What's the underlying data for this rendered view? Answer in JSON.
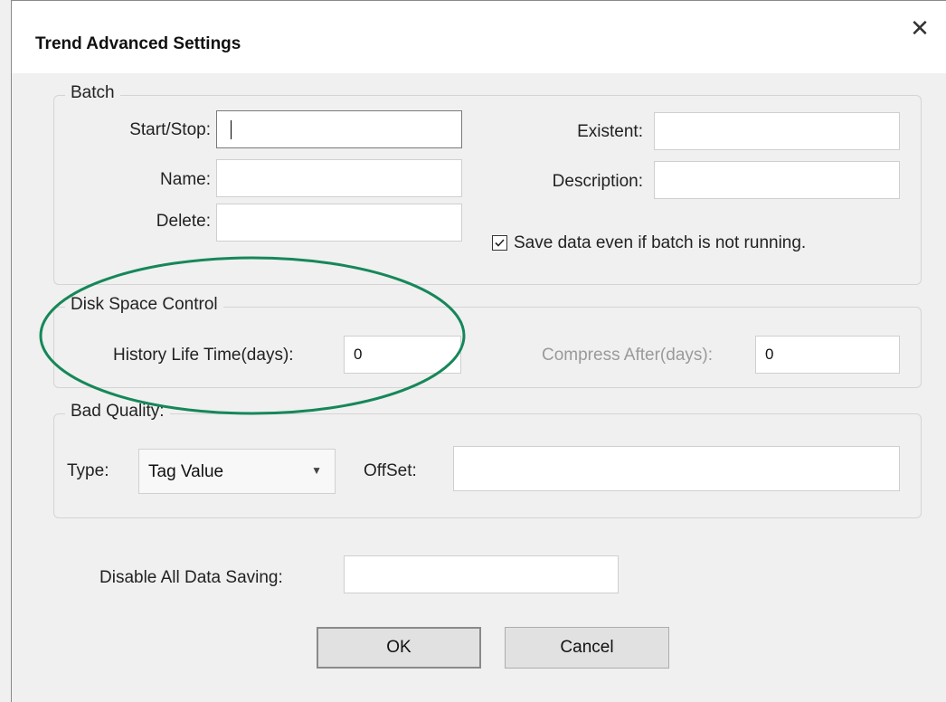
{
  "window": {
    "title": "Trend Advanced Settings",
    "close_glyph": "✕"
  },
  "batch": {
    "legend": "Batch",
    "start_stop": {
      "label": "Start/Stop:",
      "value": ""
    },
    "name": {
      "label": "Name:",
      "value": ""
    },
    "delete": {
      "label": "Delete:",
      "value": ""
    },
    "existent": {
      "label": "Existent:",
      "value": ""
    },
    "description": {
      "label": "Description:",
      "value": ""
    },
    "save_data": {
      "label": "Save data even if batch is not running.",
      "checked": true
    }
  },
  "disk_space": {
    "legend": "Disk Space Control",
    "history_life_time": {
      "label": "History Life Time(days):",
      "value": "0"
    },
    "compress_after": {
      "label": "Compress After(days):",
      "value": "0"
    }
  },
  "bad_quality": {
    "legend": "Bad Quality:",
    "type": {
      "label": "Type:",
      "selected": "Tag Value"
    },
    "offset": {
      "label": "OffSet:",
      "value": ""
    }
  },
  "disable_all": {
    "label": "Disable All Data Saving:",
    "value": ""
  },
  "buttons": {
    "ok": "OK",
    "cancel": "Cancel"
  },
  "annotation": {
    "color": "#16875a",
    "shape": "ellipse"
  }
}
